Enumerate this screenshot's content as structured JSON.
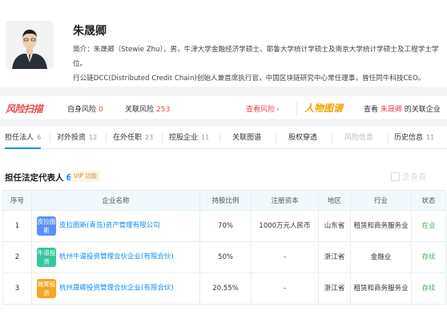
{
  "profile": {
    "name": "朱晟卿",
    "bio_line1": "简介：朱晟卿（Stewie Zhu），男，牛津大学金融经济学硕士、耶鲁大学统计学硕士及南京大学统计学硕士及工程学士学位。",
    "bio_line2": "行公链DCC(Distributed Credit Chain)创始人兼首席执行官，中国区块链研究中心常任理事，曾任同牛科技CEO。"
  },
  "risk_bar": {
    "logo": "风险扫描",
    "self_risk_label": "自身风险",
    "self_risk_count": "0",
    "related_risk_label": "关联风险",
    "related_risk_count": "253",
    "view_risk_link": "查看风险",
    "graph_logo": "人物图谱",
    "see_prefix": "查看",
    "see_name": "朱晟卿",
    "see_suffix": "的关联企业"
  },
  "tabs": [
    {
      "label": "担任法人",
      "count": "6"
    },
    {
      "label": "对外投资",
      "count": "12"
    },
    {
      "label": "在外任职",
      "count": "23"
    },
    {
      "label": "控股企业",
      "count": "11"
    },
    {
      "label": "关联图谱",
      "count": ""
    },
    {
      "label": "股权穿透",
      "count": ""
    },
    {
      "label": "风险信息",
      "count": ""
    },
    {
      "label": "历史信息",
      "count": "11"
    }
  ],
  "section": {
    "title": "担任法定代表人",
    "count": "6",
    "vip_label": "VIP 功能",
    "watermark": "企查查"
  },
  "table": {
    "headers": [
      "序号",
      "企业名称",
      "持股比例",
      "注册资本",
      "地区",
      "行业",
      "状态"
    ],
    "rows": [
      {
        "index": "1",
        "logo_text": "皮拉图斯",
        "logo_color": "#5b8ff9",
        "company": "皮拉图斯(青岛)资产管理有限公司",
        "share": "70%",
        "capital": "1000万元人民币",
        "region": "山东省",
        "industry": "租赁和商务服务业",
        "status": "在业",
        "status_color": "#3eb15d"
      },
      {
        "index": "2",
        "logo_text": "牛道投资",
        "logo_color": "#36c6a0",
        "company": "杭州牛道投资管理合伙企业(有限合伙)",
        "share": "50%",
        "capital": "-",
        "region": "浙江省",
        "industry": "金融业",
        "status": "存续",
        "status_color": "#3eb15d"
      },
      {
        "index": "3",
        "logo_text": "晟卿投资",
        "logo_color": "#f5a623",
        "company": "杭州晟卿投资管理合伙企业(有限合伙)",
        "share": "20.55%",
        "capital": "-",
        "region": "浙江省",
        "industry": "租赁和商务服务业",
        "status": "存续",
        "status_color": "#3eb15d"
      }
    ]
  }
}
